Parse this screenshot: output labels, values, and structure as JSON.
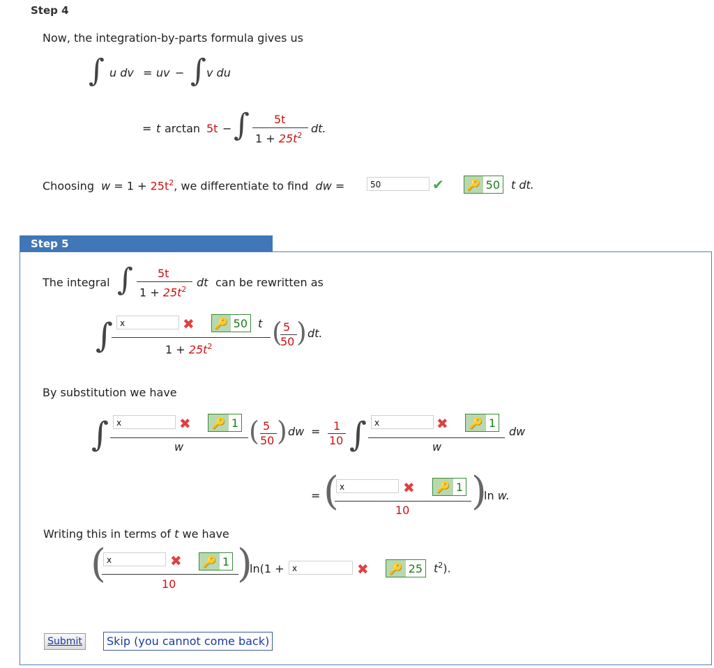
{
  "step4": {
    "title": "Step 4",
    "intro": "Now, the integration-by-parts formula gives us",
    "formula": {
      "lhs": "u dv",
      "eq": "=",
      "uv": "uv",
      "minus": "−",
      "rhs": "v du"
    },
    "line2": {
      "eq": "=",
      "t": "t",
      "arctan": "arctan",
      "coef": "5t",
      "minus": "−",
      "num": "5t",
      "den_pre": "1 + ",
      "den_red": "25t",
      "den_sup": "2",
      "dt": "dt."
    },
    "choosing": {
      "pre": "Choosing",
      "w": "w",
      "eq": "= 1 + ",
      "red": "25t",
      "sup": "2",
      "mid": ", we differentiate to find",
      "dw": "dw",
      "eq2": "="
    },
    "input_value": "50",
    "key_value": "50",
    "tail": "t dt."
  },
  "step5": {
    "title": "Step 5",
    "integral_intro": "The integral",
    "int_num": "5t",
    "int_den_pre": "1 + ",
    "int_den_red": "25t",
    "int_den_sup": "2",
    "int_tail_dt": "dt",
    "int_tail": "can be rewritten as",
    "rewrite": {
      "input": "x",
      "key": "50",
      "t": "t",
      "den_pre": "1 + ",
      "den_red": "25t",
      "den_sup": "2",
      "p_num": "5",
      "p_den": "50",
      "dt": "dt."
    },
    "subst_label": "By substitution we have",
    "subst": {
      "input1": "x",
      "key1": "1",
      "w1": "w",
      "p_num": "5",
      "p_den": "50",
      "dw1": "dw",
      "eq": "=",
      "c_num": "1",
      "c_den": "10",
      "input2": "x",
      "key2": "1",
      "w2": "w",
      "dw2": "dw"
    },
    "second": {
      "eq": "=",
      "input": "x",
      "key": "1",
      "den": "10",
      "ln": "ln",
      "w": "w."
    },
    "writing_label_pre": "Writing this in terms of",
    "writing_label_t": "t",
    "writing_label_post": "we have",
    "final": {
      "input1": "x",
      "key1": "1",
      "den": "10",
      "ln": "ln(1 + ",
      "input2": "x",
      "key2": "25",
      "t": "t",
      "sup": "2",
      "close": ")."
    }
  },
  "buttons": {
    "submit": "Submit",
    "skip": "Skip (you cannot come back)"
  }
}
